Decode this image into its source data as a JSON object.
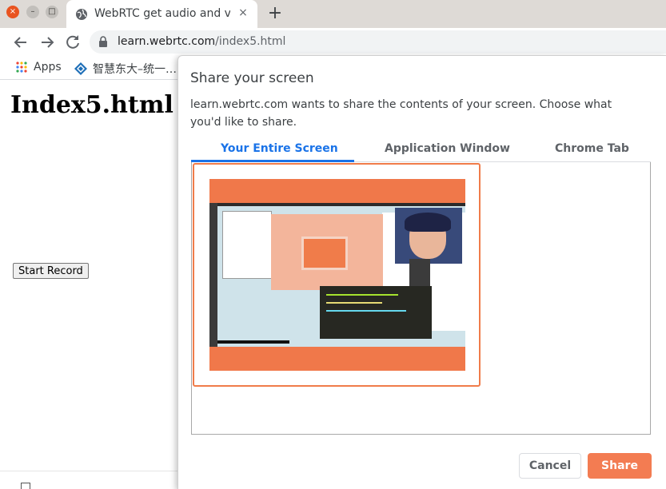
{
  "window": {
    "close_glyph": "×",
    "minimize_glyph": "–",
    "maximize_glyph": "□"
  },
  "tab": {
    "title": "WebRTC get audio and video",
    "close_glyph": "×",
    "favicon": "globe-icon"
  },
  "new_tab_glyph": "+",
  "address_bar": {
    "domain": "learn.webrtc.com",
    "path": "/index5.html"
  },
  "bookmarks": [
    {
      "label": "Apps",
      "icon": "apps-grid-icon"
    },
    {
      "label": "智慧东大–统一…",
      "icon": "site-icon"
    }
  ],
  "page": {
    "heading": "Index5.html",
    "record_button": "Start Record"
  },
  "dialog": {
    "title": "Share your screen",
    "description": "learn.webrtc.com wants to share the contents of your screen. Choose what you'd like to share.",
    "tabs": [
      {
        "label": "Your Entire Screen",
        "selected": true
      },
      {
        "label": "Application Window",
        "selected": false
      },
      {
        "label": "Chrome Tab",
        "selected": false
      }
    ],
    "cancel_label": "Cancel",
    "share_label": "Share"
  },
  "colors": {
    "accent": "#1a73e8",
    "share": "#f37c52",
    "selection_border": "#f07c4a",
    "window_close": "#e95420"
  }
}
